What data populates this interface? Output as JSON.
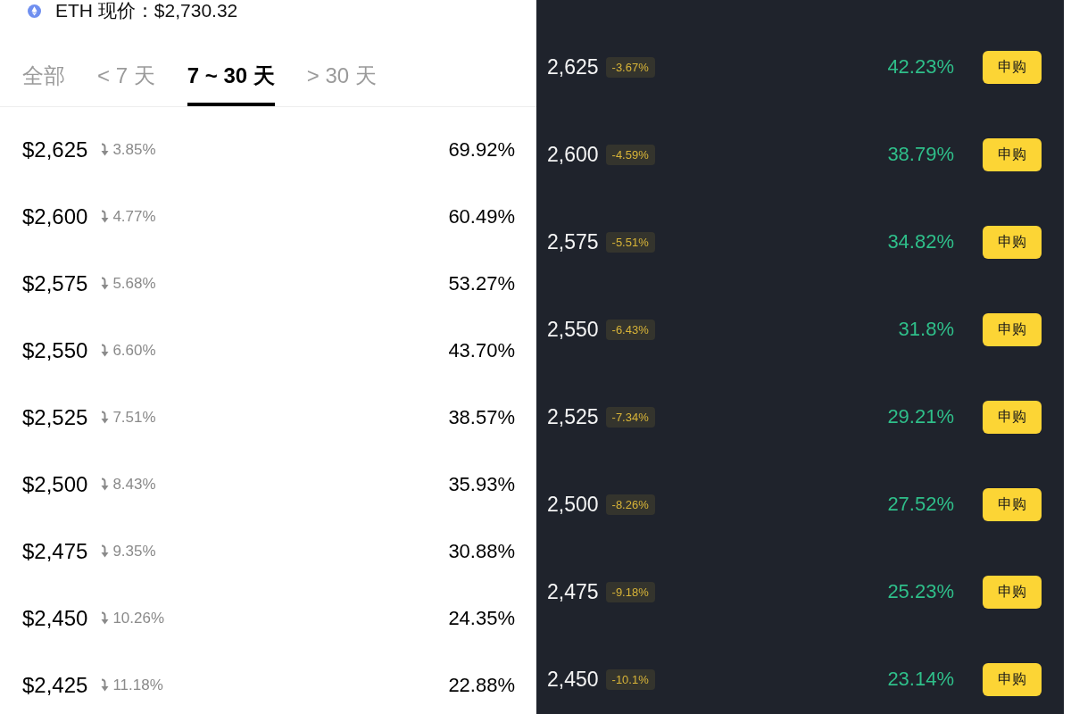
{
  "header": {
    "price_text": "ETH 现价：$2,730.32"
  },
  "tabs": [
    {
      "label": "全部",
      "selected": false
    },
    {
      "label": "< 7 天",
      "selected": false
    },
    {
      "label": "7 ~ 30 天",
      "selected": true
    },
    {
      "label": "> 30 天",
      "selected": false
    }
  ],
  "left_rows": [
    {
      "strike": "$2,625",
      "falling": true,
      "change": "3.85%",
      "yield": "69.92%"
    },
    {
      "strike": "$2,600",
      "falling": true,
      "change": "4.77%",
      "yield": "60.49%"
    },
    {
      "strike": "$2,575",
      "falling": true,
      "change": "5.68%",
      "yield": "53.27%"
    },
    {
      "strike": "$2,550",
      "falling": true,
      "change": "6.60%",
      "yield": "43.70%"
    },
    {
      "strike": "$2,525",
      "falling": true,
      "change": "7.51%",
      "yield": "38.57%"
    },
    {
      "strike": "$2,500",
      "falling": true,
      "change": "8.43%",
      "yield": "35.93%"
    },
    {
      "strike": "$2,475",
      "falling": true,
      "change": "9.35%",
      "yield": "30.88%"
    },
    {
      "strike": "$2,450",
      "falling": true,
      "change": "10.26%",
      "yield": "24.35%"
    },
    {
      "strike": "$2,425",
      "falling": true,
      "change": "11.18%",
      "yield": "22.88%"
    }
  ],
  "right_rows": [
    {
      "strike": "2,625",
      "change": "-3.67%",
      "yield": "42.23%",
      "button": "申购"
    },
    {
      "strike": "2,600",
      "change": "-4.59%",
      "yield": "38.79%",
      "button": "申购"
    },
    {
      "strike": "2,575",
      "change": "-5.51%",
      "yield": "34.82%",
      "button": "申购"
    },
    {
      "strike": "2,550",
      "change": "-6.43%",
      "yield": "31.8%",
      "button": "申购"
    },
    {
      "strike": "2,525",
      "change": "-7.34%",
      "yield": "29.21%",
      "button": "申购"
    },
    {
      "strike": "2,500",
      "change": "-8.26%",
      "yield": "27.52%",
      "button": "申购"
    },
    {
      "strike": "2,475",
      "change": "-9.18%",
      "yield": "25.23%",
      "button": "申购"
    },
    {
      "strike": "2,450",
      "change": "-10.1%",
      "yield": "23.14%",
      "button": "申购"
    }
  ]
}
